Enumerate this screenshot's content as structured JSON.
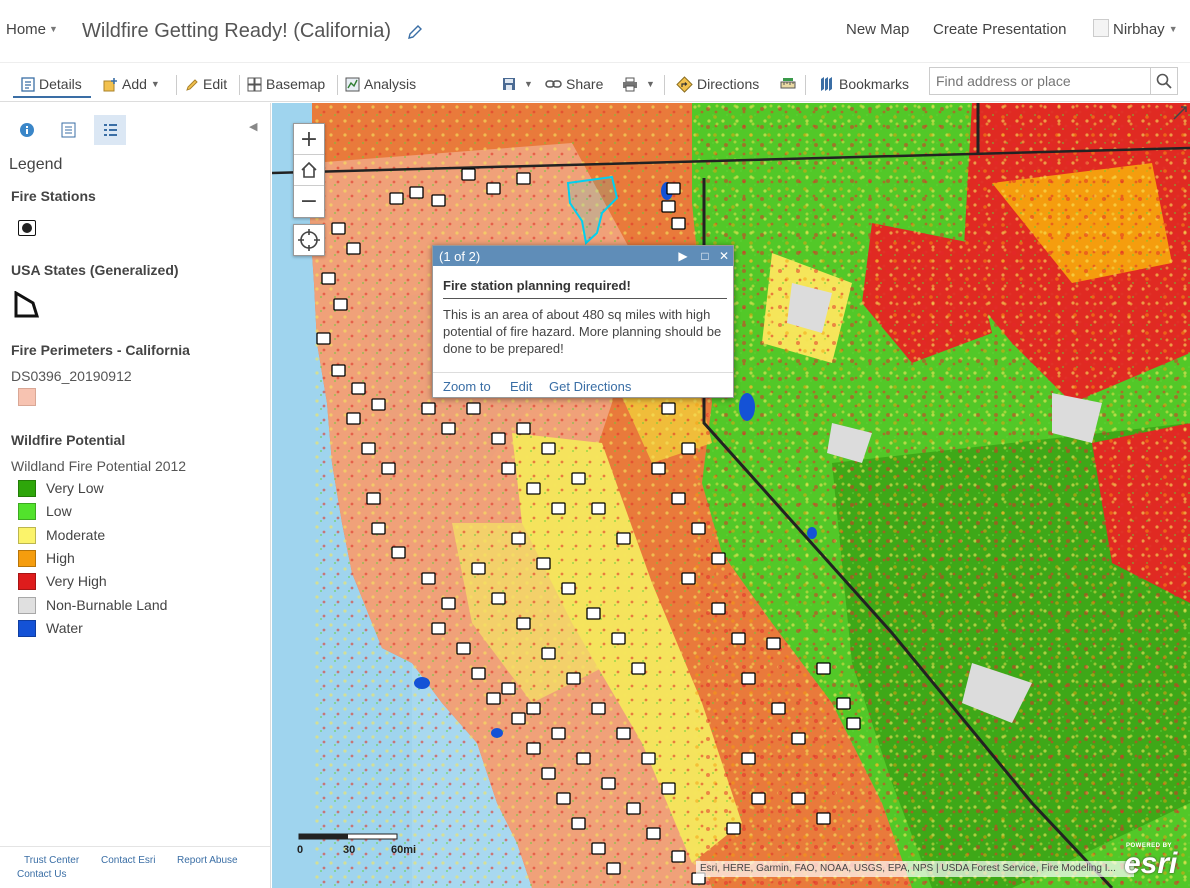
{
  "header": {
    "home_label": "Home",
    "map_title": "Wildfire Getting Ready! (California)",
    "new_map_label": "New Map",
    "create_presentation_label": "Create Presentation",
    "user_name": "Nirbhay"
  },
  "toolbar": {
    "details_label": "Details",
    "add_label": "Add",
    "edit_label": "Edit",
    "basemap_label": "Basemap",
    "analysis_label": "Analysis",
    "share_label": "Share",
    "directions_label": "Directions",
    "bookmarks_label": "Bookmarks",
    "search_placeholder": "Find address or place"
  },
  "legend": {
    "heading": "Legend",
    "layers": {
      "fire_stations": "Fire Stations",
      "usa_states": "USA States (Generalized)",
      "fire_perimeters": "Fire Perimeters - California",
      "fire_perimeters_sub": "DS0396_20190912",
      "wildfire_potential": "Wildfire Potential",
      "wildfire_potential_sub": "Wildland Fire Potential 2012"
    },
    "wildfire_classes": [
      {
        "label": "Very Low",
        "color": "#38a800"
      },
      {
        "label": "Low",
        "color": "#4ce600"
      },
      {
        "label": "Moderate",
        "color": "#ffff73"
      },
      {
        "label": "High",
        "color": "#ffaa00"
      },
      {
        "label": "Very High",
        "color": "#e60000"
      },
      {
        "label": "Non-Burnable Land",
        "color": "#e1e1e1"
      },
      {
        "label": "Water",
        "color": "#005ce6"
      }
    ]
  },
  "footer": {
    "trust_center": "Trust Center",
    "contact_esri": "Contact Esri",
    "report_abuse": "Report Abuse",
    "contact_us": "Contact Us"
  },
  "popup": {
    "count": "(1 of 2)",
    "title": "Fire station planning required!",
    "body": "This is an area of about 480 sq miles with high potential of fire hazard. More planning should be done to be prepared!",
    "zoom_to": "Zoom to",
    "edit": "Edit",
    "get_directions": "Get Directions"
  },
  "map": {
    "scale_labels": [
      "0",
      "30",
      "60mi"
    ],
    "attribution": "Esri, HERE, Garmin, FAO, NOAA, USGS, EPA, NPS | USDA Forest Service, Fire Modeling I...",
    "esri_powered": "POWERED BY",
    "esri_wordmark": "esri"
  }
}
